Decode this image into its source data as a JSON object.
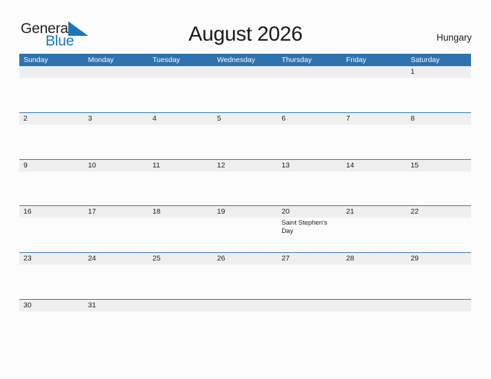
{
  "brand": {
    "name_part1": "General",
    "name_part2": "Blue",
    "flag_icon": "blue-triangle-flag-icon",
    "color_dark": "#231f20",
    "color_blue": "#1b75bc"
  },
  "header": {
    "title": "August 2026",
    "region": "Hungary"
  },
  "theme": {
    "header_blue": "#2e72b0",
    "band_gray": "#efefef",
    "rule_blue": "#2e72b0",
    "page_background": "#fcfcfc",
    "text_color": "#1a1a1a"
  },
  "calendar": {
    "month": "August",
    "year": "2026",
    "weekday_headers": [
      "Sunday",
      "Monday",
      "Tuesday",
      "Wednesday",
      "Thursday",
      "Friday",
      "Saturday"
    ],
    "weeks": [
      [
        {
          "day": "",
          "events": []
        },
        {
          "day": "",
          "events": []
        },
        {
          "day": "",
          "events": []
        },
        {
          "day": "",
          "events": []
        },
        {
          "day": "",
          "events": []
        },
        {
          "day": "",
          "events": []
        },
        {
          "day": "1",
          "events": []
        }
      ],
      [
        {
          "day": "2",
          "events": []
        },
        {
          "day": "3",
          "events": []
        },
        {
          "day": "4",
          "events": []
        },
        {
          "day": "5",
          "events": []
        },
        {
          "day": "6",
          "events": []
        },
        {
          "day": "7",
          "events": []
        },
        {
          "day": "8",
          "events": []
        }
      ],
      [
        {
          "day": "9",
          "events": []
        },
        {
          "day": "10",
          "events": []
        },
        {
          "day": "11",
          "events": []
        },
        {
          "day": "12",
          "events": []
        },
        {
          "day": "13",
          "events": []
        },
        {
          "day": "14",
          "events": []
        },
        {
          "day": "15",
          "events": []
        }
      ],
      [
        {
          "day": "16",
          "events": []
        },
        {
          "day": "17",
          "events": []
        },
        {
          "day": "18",
          "events": []
        },
        {
          "day": "19",
          "events": []
        },
        {
          "day": "20",
          "events": [
            "Saint Stephen's Day"
          ]
        },
        {
          "day": "21",
          "events": []
        },
        {
          "day": "22",
          "events": []
        }
      ],
      [
        {
          "day": "23",
          "events": []
        },
        {
          "day": "24",
          "events": []
        },
        {
          "day": "25",
          "events": []
        },
        {
          "day": "26",
          "events": []
        },
        {
          "day": "27",
          "events": []
        },
        {
          "day": "28",
          "events": []
        },
        {
          "day": "29",
          "events": []
        }
      ],
      [
        {
          "day": "30",
          "events": []
        },
        {
          "day": "31",
          "events": []
        },
        {
          "day": "",
          "events": []
        },
        {
          "day": "",
          "events": []
        },
        {
          "day": "",
          "events": []
        },
        {
          "day": "",
          "events": []
        },
        {
          "day": "",
          "events": []
        }
      ]
    ]
  }
}
